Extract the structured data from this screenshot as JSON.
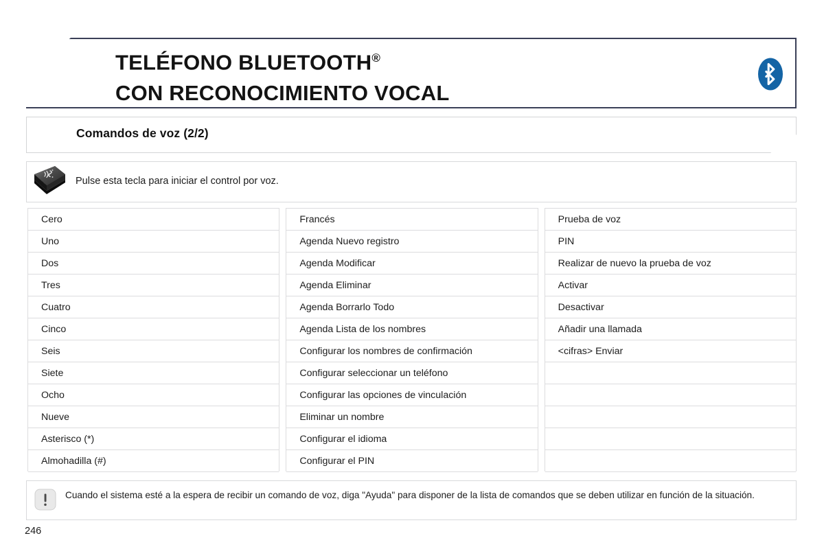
{
  "header": {
    "title_line1": "TELÉFONO BLUETOOTH",
    "registered_mark": "®",
    "title_line2": "CON RECONOCIMIENTO VOCAL",
    "logo_name": "bluetooth-logo",
    "logo_color": "#1464a5"
  },
  "subtitle": {
    "text": "Comandos de voz (2/2)"
  },
  "key_instruction": {
    "icon_name": "voice-control-key-icon",
    "text": "Pulse esta tecla para iniciar el control por voz."
  },
  "columns": [
    {
      "name": "column-numbers",
      "cells": [
        "Cero",
        "Uno",
        "Dos",
        "Tres",
        "Cuatro",
        "Cinco",
        "Seis",
        "Siete",
        "Ocho",
        "Nueve",
        "Asterisco (*)",
        "Almohadilla (#)"
      ]
    },
    {
      "name": "column-agenda-config",
      "cells": [
        "Francés",
        "Agenda Nuevo registro",
        "Agenda Modificar",
        "Agenda Eliminar",
        "Agenda Borrarlo Todo",
        "Agenda Lista de los nombres",
        "Configurar los nombres de confirmación",
        "Configurar seleccionar un teléfono",
        "Configurar las opciones de vinculación",
        "Eliminar un nombre",
        "Configurar el idioma",
        "Configurar el PIN"
      ]
    },
    {
      "name": "column-voice-pin",
      "cells": [
        "Prueba de voz",
        "PIN",
        "Realizar de nuevo la prueba de voz",
        "Activar",
        "Desactivar",
        "Añadir una llamada",
        "<cifras> Enviar",
        "",
        "",
        "",
        "",
        ""
      ]
    }
  ],
  "note": {
    "icon_name": "exclamation-icon",
    "text": "Cuando el sistema esté a la espera de recibir un comando de voz, diga \"Ayuda\" para disponer de la lista de comandos que se deben utilizar en función de la situación."
  },
  "page_number": "246"
}
